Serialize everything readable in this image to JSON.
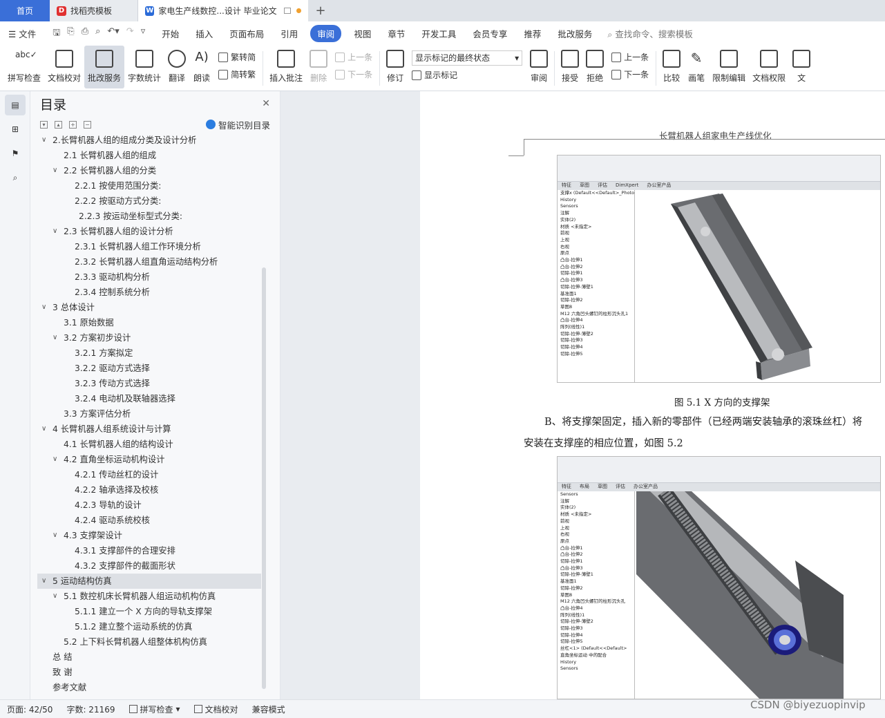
{
  "tabs": {
    "home": "首页",
    "template": "找稻壳模板",
    "doc": "家电生产线数控...设计 毕业论文",
    "add": "+"
  },
  "menu": {
    "file": "文件",
    "items": [
      "开始",
      "插入",
      "页面布局",
      "引用",
      "审阅",
      "视图",
      "章节",
      "开发工具",
      "会员专享",
      "推荐",
      "批改服务"
    ],
    "active_index": 4,
    "search": "查找命令、搜索模板"
  },
  "ribbon": {
    "spell": "拼写检查",
    "proof": "文档校对",
    "review_service": "批改服务",
    "word_count": "字数统计",
    "translate": "翻译",
    "read": "朗读",
    "trad": "繁转简",
    "simp": "简转繁",
    "insert_comment": "插入批注",
    "delete": "删除",
    "prev": "上一条",
    "next": "下一条",
    "track": "修订",
    "markup_state": "显示标记的最终状态",
    "show_markup": "显示标记",
    "reviewing": "审阅",
    "accept": "接受",
    "reject": "拒绝",
    "prev2": "上一条",
    "next2": "下一条",
    "compare": "比较",
    "pen": "画笔",
    "restrict": "限制编辑",
    "perm": "文档权限",
    "more": "文"
  },
  "toc": {
    "title": "目录",
    "smart": "智能识别目录",
    "items": [
      {
        "t": "2.长臂机器人组的组成分类及设计分析",
        "lvl": 1,
        "exp": true
      },
      {
        "t": "2.1  长臂机器人组的组成",
        "lvl": 2
      },
      {
        "t": "2.2  长臂机器人组的分类",
        "lvl": 2,
        "exp": true
      },
      {
        "t": "2.2.1  按使用范围分类:",
        "lvl": 3
      },
      {
        "t": "2.2.2 按驱动方式分类:",
        "lvl": 3
      },
      {
        "t": "2.2.3 按运动坐标型式分类:",
        "lvl": 4
      },
      {
        "t": "2.3  长臂机器人组的设计分析",
        "lvl": 2,
        "exp": true
      },
      {
        "t": "2.3.1 长臂机器人组工作环境分析",
        "lvl": 3
      },
      {
        "t": "2.3.2 长臂机器人组直角运动结构分析",
        "lvl": 3
      },
      {
        "t": "2.3.3 驱动机构分析",
        "lvl": 3
      },
      {
        "t": "2.3.4 控制系统分析",
        "lvl": 3
      },
      {
        "t": "3  总体设计",
        "lvl": 1,
        "exp": true
      },
      {
        "t": "3.1  原始数据",
        "lvl": 2
      },
      {
        "t": "3.2  方案初步设计",
        "lvl": 2,
        "exp": true
      },
      {
        "t": "3.2.1  方案拟定",
        "lvl": 3
      },
      {
        "t": "3.2.2  驱动方式选择",
        "lvl": 3
      },
      {
        "t": "3.2.3  传动方式选择",
        "lvl": 3
      },
      {
        "t": "3.2.4  电动机及联轴器选择",
        "lvl": 3
      },
      {
        "t": "3.3  方案评估分析",
        "lvl": 2
      },
      {
        "t": "4  长臂机器人组系统设计与计算",
        "lvl": 1,
        "exp": true
      },
      {
        "t": "4.1 长臂机器人组的结构设计",
        "lvl": 2
      },
      {
        "t": "4.2 直角坐标运动机构设计",
        "lvl": 2,
        "exp": true
      },
      {
        "t": "4.2.1 传动丝杠的设计",
        "lvl": 3
      },
      {
        "t": "4.2.2 轴承选择及校核",
        "lvl": 3
      },
      {
        "t": "4.2.3 导轨的设计",
        "lvl": 3
      },
      {
        "t": "4.2.4  驱动系统校核",
        "lvl": 3
      },
      {
        "t": "4.3  支撑架设计",
        "lvl": 2,
        "exp": true
      },
      {
        "t": "4.3.1 支撑部件的合理安排",
        "lvl": 3
      },
      {
        "t": "4.3.2 支撑部件的截面形状",
        "lvl": 3
      },
      {
        "t": "5  运动结构仿真",
        "lvl": 1,
        "exp": true,
        "sel": true
      },
      {
        "t": "5.1 数控机床长臂机器人组运动机构仿真",
        "lvl": 2,
        "exp": true
      },
      {
        "t": "5.1.1  建立一个 X 方向的导轨支撑架",
        "lvl": 3
      },
      {
        "t": "5.1.2 建立整个运动系统的仿真",
        "lvl": 3
      },
      {
        "t": "5.2 上下料长臂机器人组整体机构仿真",
        "lvl": 2
      },
      {
        "t": "总  结",
        "lvl": 1
      },
      {
        "t": "致  谢",
        "lvl": 1
      },
      {
        "t": "参考文献",
        "lvl": 1
      }
    ]
  },
  "page": {
    "header": "长臂机器人组家电生产线优化",
    "caption": "图 5.1  X 方向的支撑架",
    "para1": "B、将支撑架固定，插入新的零部件（已经两端安装轴承的滚珠丝杠）将",
    "para2": "安装在支撑座的相应位置，如图 5.2",
    "sw_tree1": [
      "支撑x (Default<<Default>_PhotoW",
      "History",
      "Sensors",
      "注解",
      "实体(2)",
      "材质 <未指定>",
      "前视",
      "上视",
      "右视",
      "原点",
      "凸台-拉伸1",
      "凸台-拉伸2",
      "切除-拉伸1",
      "凸台-拉伸3",
      "切除-拉伸-薄壁1",
      "基准面1",
      "切除-拉伸2",
      "草图8",
      "M12 六角凹头螺钉的柱形沉头孔1",
      "凸台-拉伸4",
      "阵列(线性)1",
      "切除-拉伸-薄壁2",
      "切除-拉伸3",
      "切除-拉伸4",
      "切除-拉伸5"
    ],
    "sw_tree2": [
      "Sensors",
      "注解",
      "实体(2)",
      "材质 <未指定>",
      "前视",
      "上视",
      "右视",
      "原点",
      "凸台-拉伸1",
      "凸台-拉伸2",
      "切除-拉伸1",
      "凸台-拉伸3",
      "切除-拉伸-薄壁1",
      "基准面1",
      "切除-拉伸2",
      "草图8",
      "M12 六角凹头螺钉的柱形沉头孔",
      "凸台-拉伸4",
      "阵列(线性)1",
      "切除-拉伸-薄壁2",
      "切除-拉伸3",
      "切除-拉伸4",
      "切除-拉伸5",
      "丝杠<1> (Default<<Default>",
      "直角坐标运动 中的配合",
      "History",
      "Sensors"
    ],
    "sw_tabs1": [
      "特征",
      "草图",
      "评估",
      "DimXpert",
      "办公室产品"
    ],
    "sw_tabs2": [
      "特征",
      "布局",
      "草图",
      "评估",
      "办公室产品"
    ]
  },
  "status": {
    "page": "页面: 42/50",
    "words": "字数: 21169",
    "spell": "拼写检查",
    "proof": "文档校对",
    "compat": "兼容模式"
  },
  "watermark": "CSDN @biyezuopinvip"
}
